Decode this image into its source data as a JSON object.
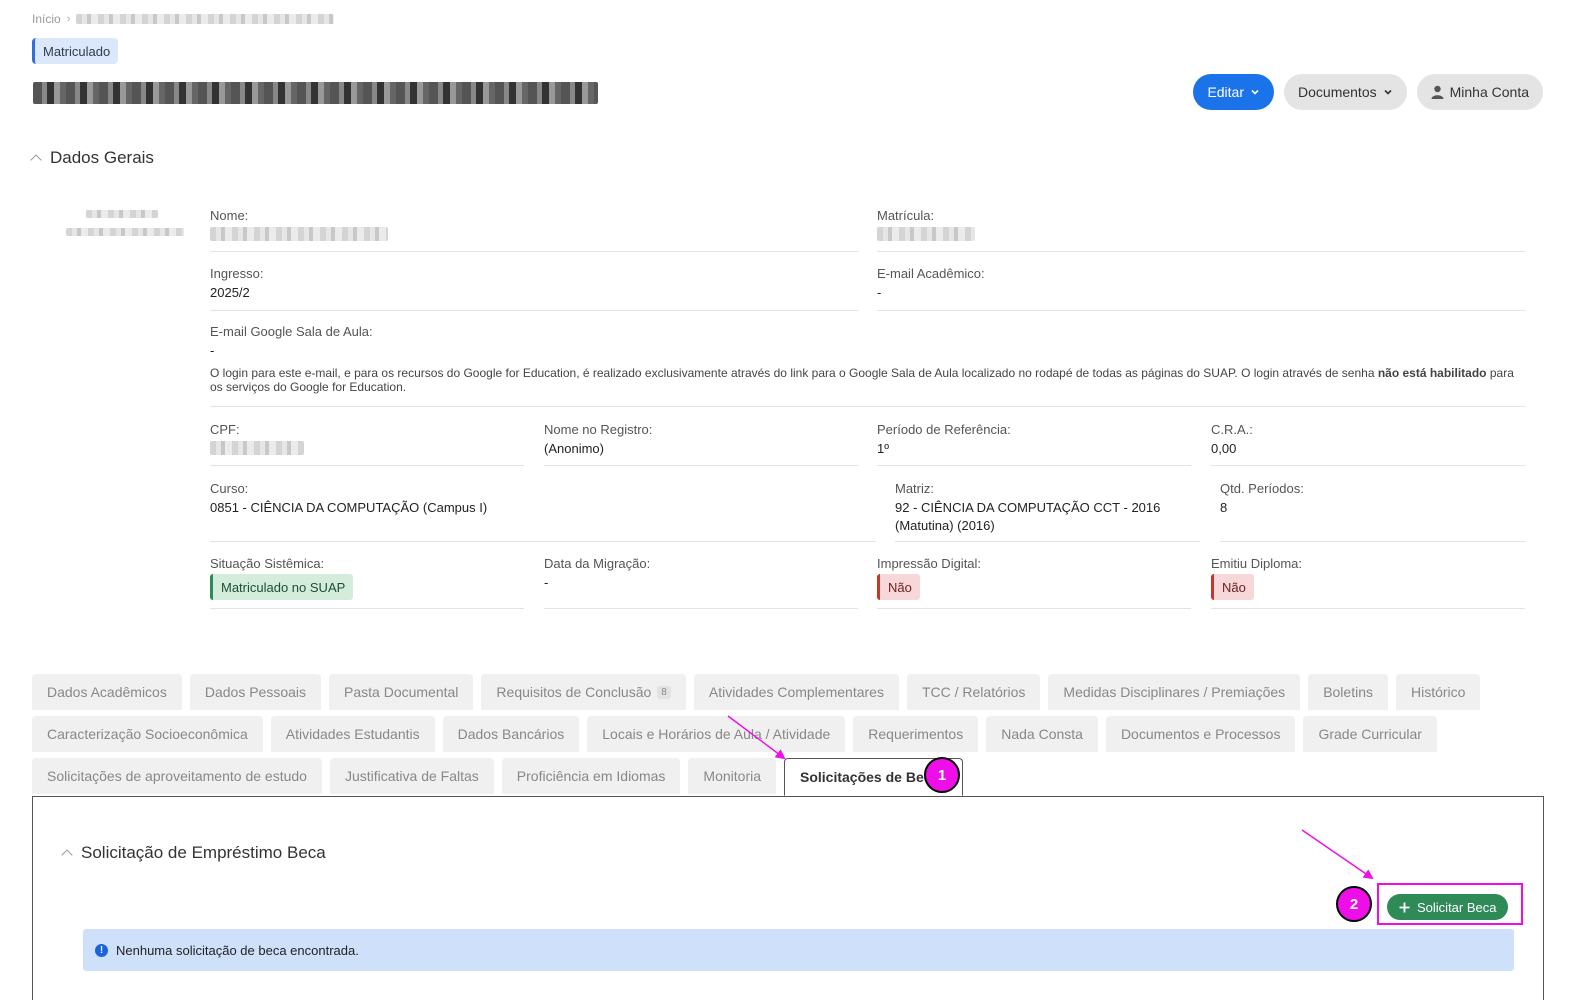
{
  "breadcrumb": {
    "home": "Início"
  },
  "status_chip": "Matriculado",
  "actions": {
    "edit": "Editar",
    "documents": "Documentos",
    "account": "Minha Conta"
  },
  "general_section": "Dados Gerais",
  "fields": {
    "nome": {
      "label": "Nome:"
    },
    "matricula": {
      "label": "Matrícula:"
    },
    "ingresso": {
      "label": "Ingresso:",
      "value": "2025/2"
    },
    "email_academico": {
      "label": "E-mail Acadêmico:",
      "value": "-"
    },
    "email_google": {
      "label": "E-mail Google Sala de Aula:",
      "value": "-",
      "note_prefix": "O login para este e-mail, e para os recursos do Google for Education, é realizado exclusivamente através do link para o Google Sala de Aula localizado no rodapé de todas as páginas do SUAP. O login através de senha ",
      "note_bold": "não está habilitado",
      "note_suffix": " para os serviços do Google for Education."
    },
    "cpf": {
      "label": "CPF:"
    },
    "nome_registro": {
      "label": "Nome no Registro:",
      "value": "(Anonimo)"
    },
    "periodo_ref": {
      "label": "Período de Referência:",
      "value": "1º"
    },
    "cra": {
      "label": "C.R.A.:",
      "value": "0,00"
    },
    "curso": {
      "label": "Curso:",
      "value": "0851 - CIÊNCIA DA COMPUTAÇÃO (Campus I)"
    },
    "matriz": {
      "label": "Matriz:",
      "value": "92 - CIÊNCIA DA COMPUTAÇÃO CCT - 2016 (Matutina) (2016)"
    },
    "qtd_periodos": {
      "label": "Qtd. Períodos:",
      "value": "8"
    },
    "situacao": {
      "label": "Situação Sistêmica:",
      "value": "Matriculado no SUAP"
    },
    "data_migracao": {
      "label": "Data da Migração:",
      "value": "-"
    },
    "impressao": {
      "label": "Impressão Digital:",
      "value": "Não"
    },
    "diploma": {
      "label": "Emitiu Diploma:",
      "value": "Não"
    }
  },
  "tabs": {
    "row1": [
      "Dados Acadêmicos",
      "Dados Pessoais",
      "Pasta Documental",
      "Requisitos de Conclusão",
      "Atividades Complementares",
      "TCC / Relatórios",
      "Medidas Disciplinares / Premiações",
      "Boletins",
      "Histórico"
    ],
    "row1_count": "8",
    "row2": [
      "Caracterização Socioeconômica",
      "Atividades Estudantis",
      "Dados Bancários",
      "Locais e Horários de Aula / Atividade",
      "Requerimentos",
      "Nada Consta",
      "Documentos e Processos",
      "Grade Curricular"
    ],
    "row3": [
      "Solicitações de aproveitamento de estudo",
      "Justificativa de Faltas",
      "Proficiência em Idiomas",
      "Monitoria",
      "Solicitações de Becas"
    ]
  },
  "panel": {
    "title": "Solicitação de Empréstimo Beca",
    "button": "Solicitar Beca",
    "alert": "Nenhuma solicitação de beca encontrada."
  },
  "annotations": {
    "step1": "1",
    "step2": "2",
    "color": "#ee0ee8"
  },
  "colors": {
    "primary": "#1a73e8",
    "success": "#2e8a57",
    "danger": "#c0392b",
    "info_bg": "#cfe0fb"
  }
}
